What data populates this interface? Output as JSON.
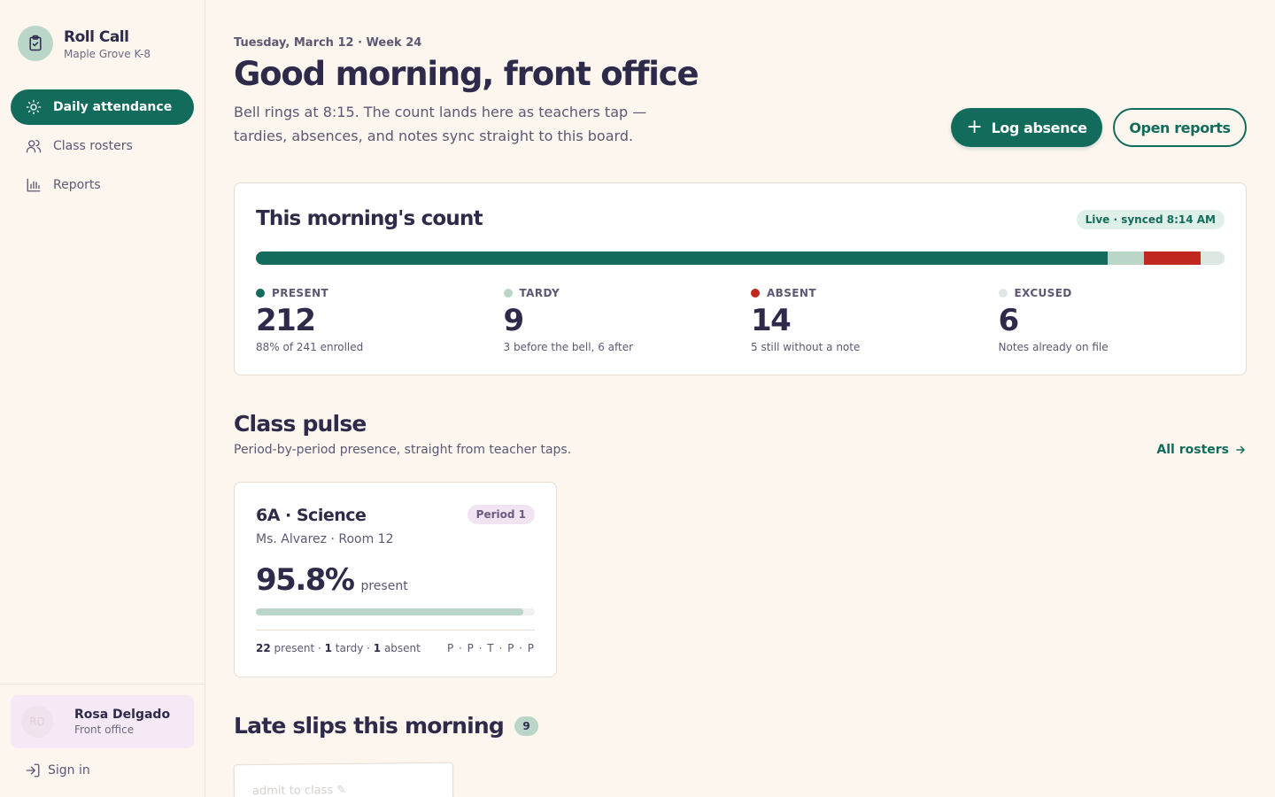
{
  "brand": {
    "title": "Roll Call",
    "subtitle": "Maple Grove K-8",
    "icon": "clipboard-check-icon"
  },
  "nav": [
    {
      "label": "Daily attendance",
      "icon": "sun-icon",
      "active": true
    },
    {
      "label": "Class rosters",
      "icon": "users-icon",
      "active": false
    },
    {
      "label": "Reports",
      "icon": "bar-chart-icon",
      "active": false
    }
  ],
  "user": {
    "initials": "RD",
    "name": "Rosa Delgado",
    "role": "Front office"
  },
  "signin": {
    "label": "Sign in",
    "icon": "sign-in-icon"
  },
  "header": {
    "dateline": "Tuesday, March 12 · Week 24",
    "title": "Good morning, front office",
    "intro": "Bell rings at 8:15. The count lands here as teachers tap — tardies, absences, and notes sync straight to this board.",
    "primary_button": "Log absence",
    "secondary_button": "Open reports"
  },
  "count": {
    "title": "This morning's count",
    "badge": "Live · synced 8:14 AM",
    "bar_segments": [
      {
        "name": "present",
        "value": 212,
        "color": "#136b5c"
      },
      {
        "name": "tardy",
        "value": 9,
        "color": "#b9d6c8"
      },
      {
        "name": "absent",
        "value": 14,
        "color": "#c0281f"
      },
      {
        "name": "excused",
        "value": 6,
        "color": "#dde8e2"
      }
    ],
    "stats": [
      {
        "label": "PRESENT",
        "value": "212",
        "note": "88% of 241 enrolled",
        "color": "#136b5c"
      },
      {
        "label": "TARDY",
        "value": "9",
        "note": "3 before the bell, 6 after",
        "color": "#b9d6c8"
      },
      {
        "label": "ABSENT",
        "value": "14",
        "note": "5 still without a note",
        "color": "#c0281f"
      },
      {
        "label": "EXCUSED",
        "value": "6",
        "note": "Notes already on file",
        "color": "#dde8e2"
      }
    ]
  },
  "pulse": {
    "title": "Class pulse",
    "subtitle": "Period-by-period presence, straight from teacher taps.",
    "link": "All rosters",
    "cards": [
      {
        "title": "6A · Science",
        "period": "Period 1",
        "teacher": "Ms. Alvarez · Room 12",
        "percent": "95.8%",
        "percent_label": "present",
        "fill": 0.958,
        "present": "22",
        "present_label": "present",
        "tardy": "1",
        "tardy_label": "tardy",
        "absent": "1",
        "absent_label": "absent",
        "marks": "P · P · T · P · P"
      }
    ]
  },
  "late": {
    "title": "Late slips this morning",
    "count": "9",
    "slip_text": "admit to class ✎"
  }
}
